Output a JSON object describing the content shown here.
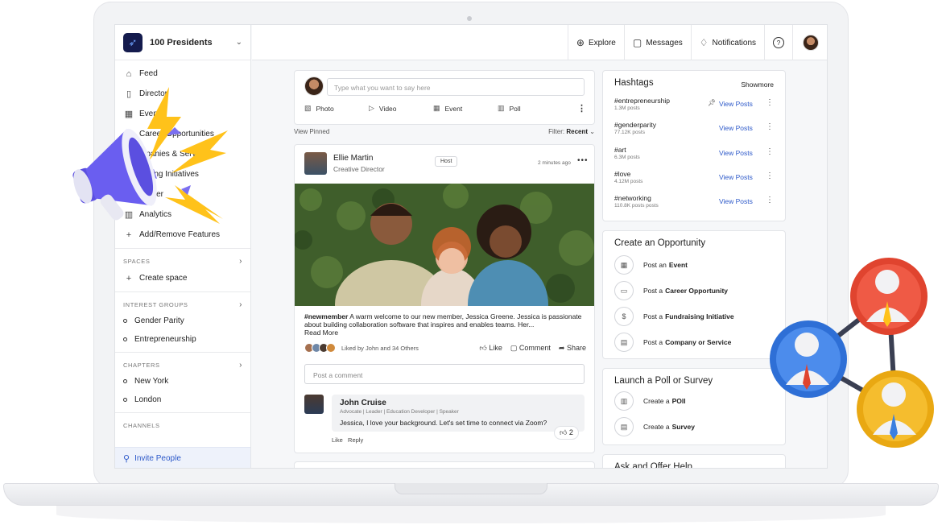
{
  "brand": {
    "name": "100 Presidents"
  },
  "nav": [
    {
      "label": "Feed",
      "icon": "home-icon"
    },
    {
      "label": "Director",
      "icon": "book-icon"
    },
    {
      "label": "Even",
      "icon": "calendar-icon"
    },
    {
      "label": "Career Opportunities",
      "icon": "briefcase-icon"
    },
    {
      "label": "mpanies & Services",
      "icon": "building-icon"
    },
    {
      "label": "raising Initiatives",
      "icon": "dollar-icon"
    },
    {
      "label": "Center",
      "icon": "help-icon"
    },
    {
      "label": "Analytics",
      "icon": "chart-icon"
    },
    {
      "label": "Add/Remove Features",
      "icon": "plus-icon"
    }
  ],
  "spaces": {
    "heading": "SPACES",
    "items": [
      "Create space"
    ]
  },
  "interest_groups": {
    "heading": "INTEREST GROUPS",
    "items": [
      "Gender Parity",
      "Entrepreneurship"
    ]
  },
  "chapters": {
    "heading": "CHAPTERS",
    "items": [
      "New York",
      "London"
    ]
  },
  "channels": {
    "heading": "CHANNELS"
  },
  "invite": {
    "label": "Invite People"
  },
  "topbar": {
    "explore": "Explore",
    "messages": "Messages",
    "notifications": "Notifications",
    "help": "?"
  },
  "composer": {
    "placeholder": "Type what you want to say here",
    "photo": "Photo",
    "video": "Video",
    "event": "Event",
    "poll": "Poll"
  },
  "pinned": {
    "label": "View Pinned",
    "filter_label": "Filter:",
    "filter_value": "Recent"
  },
  "post": {
    "author": "Ellie Martin",
    "role": "Creative Director",
    "badge": "Host",
    "time": "2 minutes ago",
    "hashtag": "#newmember",
    "text": " A warm welcome to our new member, Jessica Greene. Jessica is passionate about building collaboration software that inspires and enables teams. Her...",
    "read_more": "Read More",
    "liked_by": "Liked by John and 34 Others",
    "like": "Like",
    "comment": "Comment",
    "share": "Share",
    "comment_placeholder": "Post a comment"
  },
  "reply": {
    "name": "John Cruise",
    "role": "Advocate | Leader | Education Developer | Speaker",
    "message": "Jessica, I love your background. Let's set time to connect via Zoom?",
    "likes": "2",
    "like": "Like",
    "reply": "Reply"
  },
  "hashtags": {
    "title": "Hashtags",
    "show_more": "Showmore",
    "view_label": "View Posts",
    "items": [
      {
        "tag": "#entrepreneurship",
        "count": "1.3M posts"
      },
      {
        "tag": "#genderparity",
        "count": "77.12K posts"
      },
      {
        "tag": "#art",
        "count": "6.3M posts"
      },
      {
        "tag": "#love",
        "count": "4.12M posts"
      },
      {
        "tag": "#networking",
        "count": "110.8K posts posts"
      }
    ]
  },
  "opportunity": {
    "title": "Create an Opportunity",
    "items": [
      {
        "prefix": "Post an",
        "bold": "Event"
      },
      {
        "prefix": "Post a",
        "bold": "Career Opportunity"
      },
      {
        "prefix": "Post a",
        "bold": "Fundraising Initiative"
      },
      {
        "prefix": "Post a",
        "bold": "Company or Service"
      }
    ]
  },
  "poll": {
    "title": "Launch a Poll or Survey",
    "items": [
      {
        "prefix": "Create a",
        "bold": "POll"
      },
      {
        "prefix": "Create a",
        "bold": "Survey"
      }
    ]
  },
  "ask": {
    "title": "Ask and Offer Help"
  },
  "colors": {
    "accent": "#2d59c9",
    "brand": "#141b4d",
    "megaphone": "#5b4fe0",
    "bolt": "#ffc21a",
    "node_red": "#e0442f",
    "node_blue": "#3b7fe0",
    "node_yellow": "#f2b51d"
  }
}
